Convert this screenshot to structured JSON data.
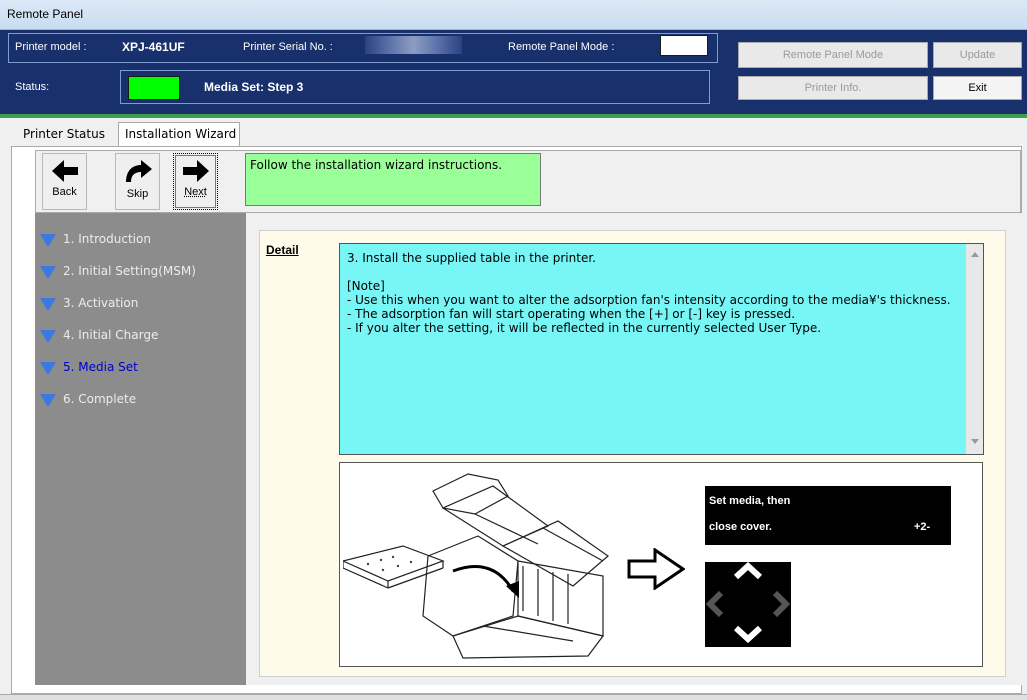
{
  "window": {
    "title": "Remote Panel"
  },
  "header": {
    "printer_model_label": "Printer model :",
    "printer_model_value": "XPJ-461UF",
    "serial_label": "Printer Serial No. :",
    "mode_label": "Remote Panel Mode :",
    "status_label": "Status:",
    "status_text": "Media Set: Step 3",
    "status_color": "#00ff00",
    "buttons": {
      "remote_panel_mode": "Remote Panel Mode",
      "update": "Update",
      "printer_info": "Printer Info.",
      "exit": "Exit"
    }
  },
  "tabs": [
    {
      "label": "Printer Status",
      "active": false
    },
    {
      "label": "Installation Wizard",
      "active": true
    }
  ],
  "toolbar": {
    "back": "Back",
    "skip": "Skip",
    "next": "Next",
    "message": "Follow the installation wizard instructions."
  },
  "steps": [
    {
      "label": "1. Introduction",
      "current": false
    },
    {
      "label": "2. Initial Setting(MSM)",
      "current": false
    },
    {
      "label": "3. Activation",
      "current": false
    },
    {
      "label": "4. Initial Charge",
      "current": false
    },
    {
      "label": "5. Media Set",
      "current": true
    },
    {
      "label": "6. Complete",
      "current": false
    }
  ],
  "detail": {
    "label": "Detail",
    "lines": [
      "3. Install the supplied table in the printer.",
      "",
      "[Note]",
      " - Use this when you want to alter the adsorption fan's intensity according to the media¥'s thickness.",
      " - The adsorption fan will start operating when the [+] or [-] key is pressed.",
      " - If you alter the setting, it will be reflected in the currently selected User Type."
    ]
  },
  "illustration": {
    "lcd_line1": "Set media, then",
    "lcd_line2": "close cover.",
    "lcd_value": "+2-"
  }
}
